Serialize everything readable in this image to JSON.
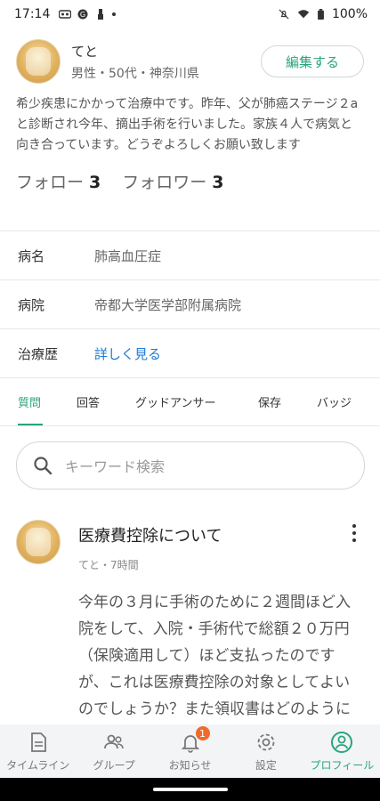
{
  "status_bar": {
    "time": "17:14",
    "battery": "100%"
  },
  "profile": {
    "name": "てと",
    "meta": "男性・50代・神奈川県",
    "edit_label": "編集する",
    "bio": "希少疾患にかかって治療中です。昨年、父が肺癌ステージ２aと診断され今年、摘出手術を行いました。家族４人で病気と向き合っています。どうぞよろしくお願い致します",
    "follow_label": "フォロー",
    "follow_count": "3",
    "follower_label": "フォロワー",
    "follower_count": "3"
  },
  "info": {
    "disease_label": "病名",
    "disease_value": "肺高血圧症",
    "hospital_label": "病院",
    "hospital_value": "帝都大学医学部附属病院",
    "history_label": "治療歴",
    "history_link": "詳しく見る"
  },
  "tabs": [
    "質問",
    "回答",
    "グッドアンサー",
    "保存",
    "バッジ"
  ],
  "search": {
    "placeholder": "キーワード検索"
  },
  "post": {
    "title": "医療費控除について",
    "meta": "てと・7時間",
    "body": "今年の３月に手術のために２週間ほど入院をして、入院・手術代で総額２０万円（保険適用して）ほど支払ったのですが、これは医療費控除の対象としてよいのでしょうか？また領収書はどのように保管すれば"
  },
  "bottom_nav": [
    {
      "label": "タイムライン",
      "icon": "document-icon"
    },
    {
      "label": "グループ",
      "icon": "group-icon"
    },
    {
      "label": "お知らせ",
      "icon": "bell-icon",
      "badge": "1"
    },
    {
      "label": "設定",
      "icon": "gear-icon"
    },
    {
      "label": "プロフィール",
      "icon": "profile-icon"
    }
  ],
  "colors": {
    "accent": "#2aa57a",
    "link": "#1a7ad6",
    "badge": "#f06a2b"
  }
}
